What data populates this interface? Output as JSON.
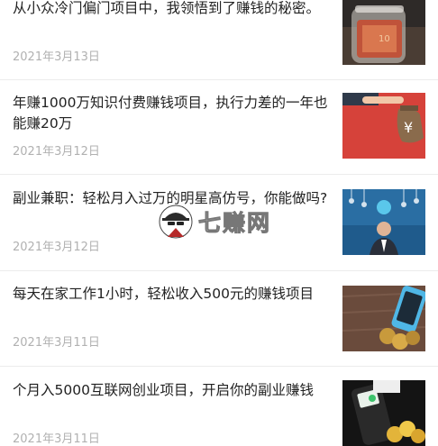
{
  "articles": [
    {
      "title": "从小众冷门偏门项目中，我领悟到了赚钱的秘密。",
      "date": "2021年3月13日",
      "thumb_icon": "money-jar-image"
    },
    {
      "title": "年赚1000万知识付费赚钱项目，执行力差的一年也能赚20万",
      "date": "2021年3月12日",
      "thumb_icon": "yuan-money-bag-image"
    },
    {
      "title": "副业兼职：轻松月入过万的明星高仿号，你能做吗?",
      "date": "2021年3月12日",
      "thumb_icon": "businessman-lightbulbs-image"
    },
    {
      "title": "每天在家工作1小时，轻松收入500元的赚钱项目",
      "date": "2021年3月11日",
      "thumb_icon": "phone-coins-image"
    },
    {
      "title": "个月入5000互联网创业项目，开启你的副业赚钱",
      "date": "2021年3月11日",
      "thumb_icon": "card-terminal-coins-image"
    }
  ],
  "watermark": {
    "text": "七赚网",
    "icon": "spy-mascot-icon"
  }
}
